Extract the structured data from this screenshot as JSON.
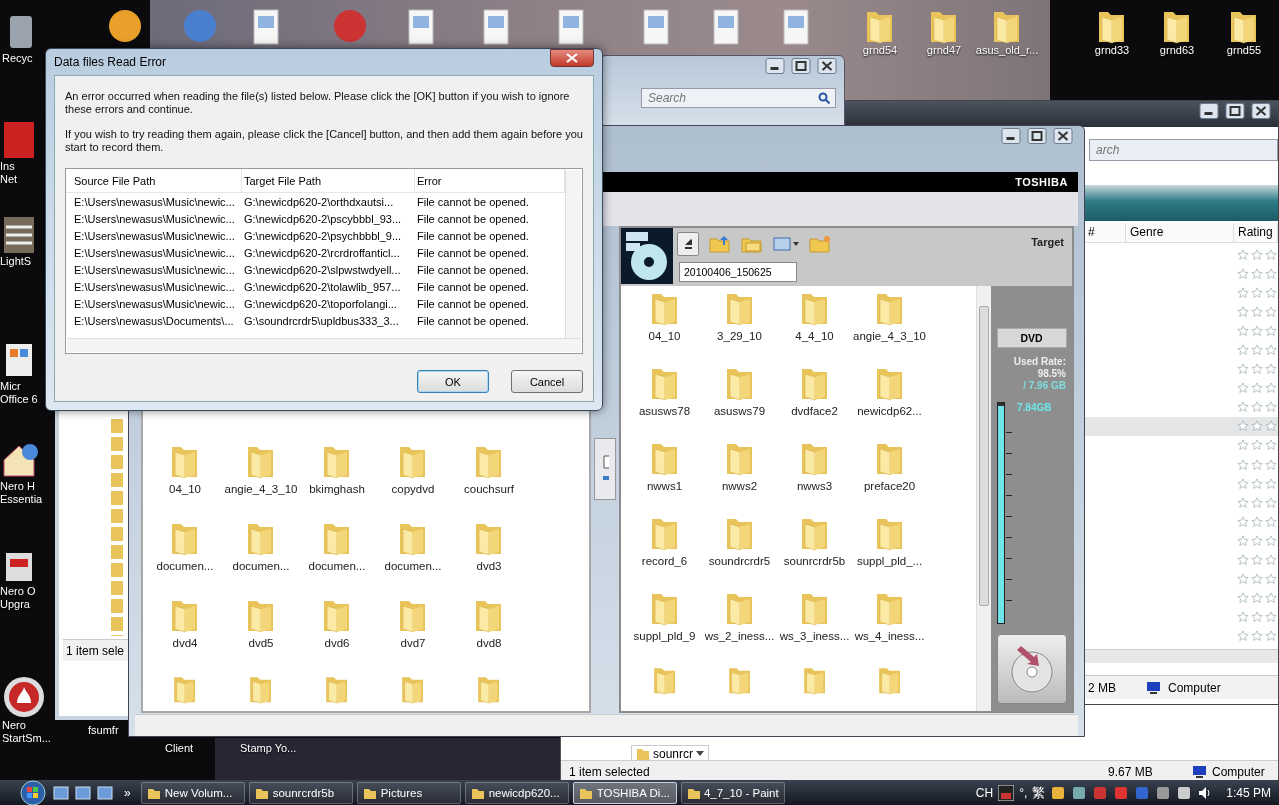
{
  "desktop": {
    "left_icons": [
      {
        "lines": [
          "Recyc"
        ]
      },
      {
        "lines": [
          "Ins",
          "Net"
        ]
      },
      {
        "lines": [
          "LightS"
        ]
      },
      {
        "lines": [
          "Micr",
          "Office 6"
        ]
      },
      {
        "lines": [
          "Nero H",
          "Essentia"
        ]
      },
      {
        "lines": [
          "Nero O",
          "Upgra"
        ]
      },
      {
        "lines": [
          "Nero",
          "StartSm..."
        ]
      }
    ],
    "bottom_icons": [
      {
        "lines": [
          "fsumfr"
        ]
      },
      {
        "lines": [
          "Client"
        ]
      },
      {
        "lines": [
          "Stamp Yo..."
        ]
      }
    ],
    "top_icons": [
      {
        "label": "grnd54"
      },
      {
        "label": "grnd47"
      },
      {
        "label": "asus_old_r..."
      },
      {
        "label": "grnd33"
      },
      {
        "label": "grnd63"
      },
      {
        "label": "grnd55"
      }
    ]
  },
  "search_window": {
    "search": {
      "placeholder": "Search"
    }
  },
  "music_window": {
    "search": {
      "placeholder": "arch"
    },
    "columns": [
      "#",
      "Genre",
      "Rating"
    ],
    "rows": [
      {
        "stars": 0,
        "selected": false
      },
      {
        "stars": 0,
        "selected": false
      },
      {
        "stars": 0,
        "selected": false
      },
      {
        "stars": 0,
        "selected": false
      },
      {
        "stars": 0,
        "selected": false
      },
      {
        "stars": 0,
        "selected": false
      },
      {
        "stars": 0,
        "selected": false
      },
      {
        "stars": 0,
        "selected": false
      },
      {
        "stars": 0,
        "selected": false
      },
      {
        "stars": 0,
        "selected": true
      },
      {
        "stars": 0,
        "selected": false
      },
      {
        "stars": 0,
        "selected": false
      },
      {
        "stars": 0,
        "selected": false
      },
      {
        "stars": 0,
        "selected": false
      },
      {
        "stars": 0,
        "selected": false
      },
      {
        "stars": 0,
        "selected": false
      },
      {
        "stars": 0,
        "selected": false
      },
      {
        "stars": 0,
        "selected": false
      },
      {
        "stars": 0,
        "selected": false
      },
      {
        "stars": 0,
        "selected": false
      },
      {
        "stars": 0,
        "selected": false
      }
    ],
    "status_bar": {
      "size": "2 MB",
      "location": "Computer"
    }
  },
  "folder_window": {
    "breadcrumb": "sounrcr",
    "status_bar": {
      "selection": "1 item selected",
      "size": "9.67 MB",
      "location": "Computer"
    }
  },
  "left_window": {
    "status_bar": {
      "selection": "1 item sele"
    }
  },
  "toshiba_window": {
    "brand": "TOSHIBA",
    "source_folders": [
      "04_10",
      "angie_4_3_10",
      "bkimghash",
      "copydvd",
      "couchsurf",
      "documen...",
      "documen...",
      "documen...",
      "documen...",
      "dvd3",
      "dvd4",
      "dvd5",
      "dvd6",
      "dvd7",
      "dvd8"
    ],
    "target": {
      "title": "Target",
      "disc_name": "20100406_150625",
      "folders": [
        "04_10",
        "3_29_10",
        "4_4_10",
        "angie_4_3_10",
        "asusws78",
        "asusws79",
        "dvdface2",
        "newicdp62...",
        "nwws1",
        "nwws2",
        "nwws3",
        "preface20",
        "record_6",
        "soundrcrdr5",
        "sounrcrdr5b",
        "suppl_pld_...",
        "suppl_pld_9",
        "ws_2_iness...",
        "ws_3_iness...",
        "ws_4_iness..."
      ],
      "media": "DVD",
      "used_rate_label": "Used Rate:",
      "used_rate": "98.5%",
      "capacity": "/ 7.96 GB",
      "used_size": "7.84GB",
      "level": 0.985
    }
  },
  "dialog": {
    "title": "Data files Read Error",
    "messages": [
      "An error occurred when reading the file(s) listed below.  Please click the [OK] button if you wish to ignore these errors and continue.",
      "If you wish to try reading them again, please click the [Cancel] button, and then add them again before you start to record them."
    ],
    "columns": [
      "Source File Path",
      "Target File Path",
      "Error"
    ],
    "rows": [
      [
        "E:\\Users\\newasus\\Music\\newic...",
        "G:\\newicdp620-2\\orthdxautsi...",
        "File cannot be opened."
      ],
      [
        "E:\\Users\\newasus\\Music\\newic...",
        "G:\\newicdp620-2\\pscybbbl_93...",
        "File cannot be opened."
      ],
      [
        "E:\\Users\\newasus\\Music\\newic...",
        "G:\\newicdp620-2\\psychbbbl_9...",
        "File cannot be opened."
      ],
      [
        "E:\\Users\\newasus\\Music\\newic...",
        "G:\\newicdp620-2\\rcrdroffanticl...",
        "File cannot be opened."
      ],
      [
        "E:\\Users\\newasus\\Music\\newic...",
        "G:\\newicdp620-2\\slpwstwdyell...",
        "File cannot be opened."
      ],
      [
        "E:\\Users\\newasus\\Music\\newic...",
        "G:\\newicdp620-2\\tolawlib_957...",
        "File cannot be opened."
      ],
      [
        "E:\\Users\\newasus\\Music\\newic...",
        "G:\\newicdp620-2\\toporfolangi...",
        "File cannot be opened."
      ],
      [
        "E:\\Users\\newasus\\Documents\\...",
        "G:\\soundrcrdr5\\upldbus333_3...",
        "File cannot be opened."
      ]
    ],
    "buttons": [
      "OK",
      "Cancel"
    ]
  },
  "taskbar": {
    "tasks": [
      {
        "label": "New Volum...",
        "selected": false
      },
      {
        "label": "sounrcrdr5b",
        "selected": false
      },
      {
        "label": "Pictures",
        "selected": false
      },
      {
        "label": "newicdp620...",
        "selected": false
      },
      {
        "label": "TOSHIBA Di...",
        "selected": true
      },
      {
        "label": "4_7_10 - Paint",
        "selected": false
      }
    ],
    "more": "»",
    "tray": {
      "language": "CH",
      "ime_marks": "°,",
      "ime_mode": "繁",
      "time": "1:45 PM"
    }
  }
}
